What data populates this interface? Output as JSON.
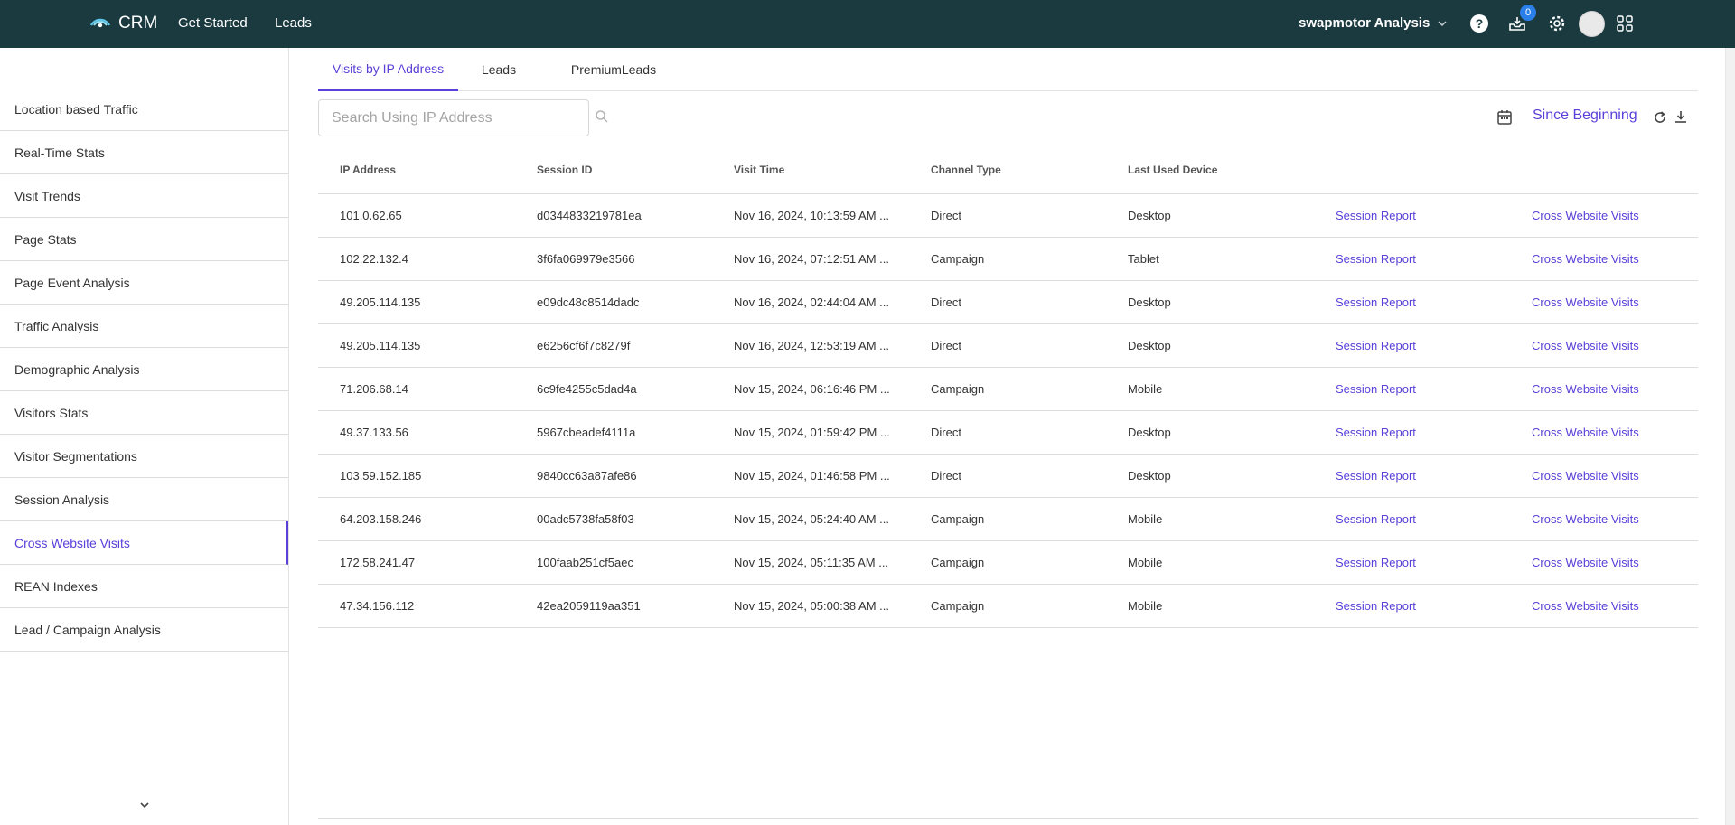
{
  "header": {
    "brand": "CRM",
    "nav": [
      "Get Started",
      "Leads"
    ],
    "project": "swapmotor Analysis",
    "notification_count": "0",
    "icons": [
      "help-icon",
      "inbox-icon",
      "gear-icon",
      "avatar",
      "apps-grid-icon"
    ],
    "colors": {
      "bar": "#1b3a40",
      "badge": "#2b7fe8"
    }
  },
  "sidebar": {
    "items": [
      "Location based Traffic",
      "Real-Time Stats",
      "Visit Trends",
      "Page Stats",
      "Page Event Analysis",
      "Traffic Analysis",
      "Demographic Analysis",
      "Visitors Stats",
      "Visitor Segmentations",
      "Session Analysis",
      "Cross Website Visits",
      "REAN Indexes",
      "Lead / Campaign Analysis"
    ],
    "active": "Cross Website Visits"
  },
  "tabs": [
    "Visits by IP Address",
    "Leads",
    "PremiumLeads"
  ],
  "active_tab": "Visits by IP Address",
  "search": {
    "placeholder": "Search Using IP Address",
    "value": ""
  },
  "date_range": "Since Beginning",
  "accent_color": "#5a3fd8",
  "table": {
    "columns": [
      "IP Address",
      "Session ID",
      "Visit Time",
      "Channel Type",
      "Last Used Device",
      "",
      ""
    ],
    "rows": [
      [
        "101.0.62.65",
        "d0344833219781ea",
        "Nov 16, 2024, 10:13:59 AM ...",
        "Direct",
        "Desktop",
        "Session Report",
        "Cross Website Visits"
      ],
      [
        "102.22.132.4",
        "3f6fa069979e3566",
        "Nov 16, 2024, 07:12:51 AM ...",
        "Campaign",
        "Tablet",
        "Session Report",
        "Cross Website Visits"
      ],
      [
        "49.205.114.135",
        "e09dc48c8514dadc",
        "Nov 16, 2024, 02:44:04 AM ...",
        "Direct",
        "Desktop",
        "Session Report",
        "Cross Website Visits"
      ],
      [
        "49.205.114.135",
        "e6256cf6f7c8279f",
        "Nov 16, 2024, 12:53:19 AM ...",
        "Direct",
        "Desktop",
        "Session Report",
        "Cross Website Visits"
      ],
      [
        "71.206.68.14",
        "6c9fe4255c5dad4a",
        "Nov 15, 2024, 06:16:46 PM ...",
        "Campaign",
        "Mobile",
        "Session Report",
        "Cross Website Visits"
      ],
      [
        "49.37.133.56",
        "5967cbeadef4111a",
        "Nov 15, 2024, 01:59:42 PM ...",
        "Direct",
        "Desktop",
        "Session Report",
        "Cross Website Visits"
      ],
      [
        "103.59.152.185",
        "9840cc63a87afe86",
        "Nov 15, 2024, 01:46:58 PM ...",
        "Direct",
        "Desktop",
        "Session Report",
        "Cross Website Visits"
      ],
      [
        "64.203.158.246",
        "00adc5738fa58f03",
        "Nov 15, 2024, 05:24:40 AM ...",
        "Campaign",
        "Mobile",
        "Session Report",
        "Cross Website Visits"
      ],
      [
        "172.58.241.47",
        "100faab251cf5aec",
        "Nov 15, 2024, 05:11:35 AM ...",
        "Campaign",
        "Mobile",
        "Session Report",
        "Cross Website Visits"
      ],
      [
        "47.34.156.112",
        "42ea2059119aa351",
        "Nov 15, 2024, 05:00:38 AM ...",
        "Campaign",
        "Mobile",
        "Session Report",
        "Cross Website Visits"
      ]
    ]
  }
}
